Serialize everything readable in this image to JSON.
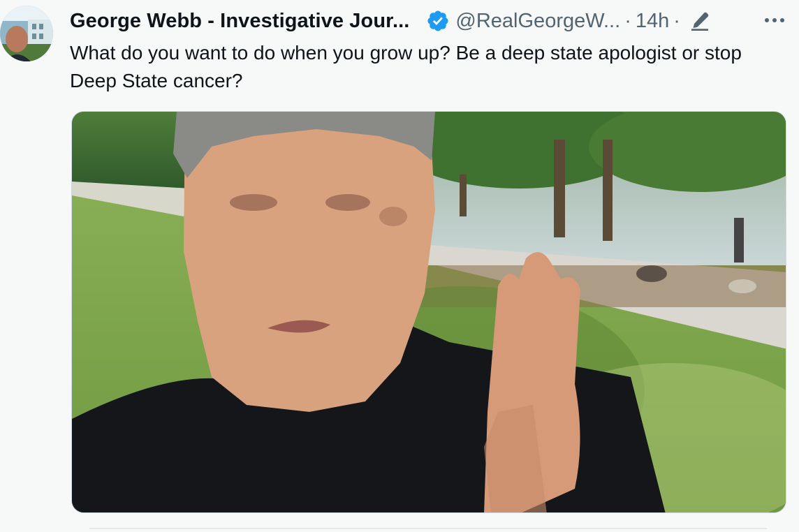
{
  "tweet": {
    "author": {
      "display_name": "George Webb - Investigative Jour...",
      "handle": "@RealGeorgeW...",
      "verified": true,
      "avatar_icon": "avatar"
    },
    "separator": "·",
    "timestamp": "14h",
    "icons": {
      "verified": "verified-badge-icon",
      "edited": "edit-icon",
      "more": "more-options-icon"
    },
    "text": "What do you want to do when you grow up? Be a deep state apologist or stop Deep State cancer?",
    "media": {
      "type": "video-thumbnail"
    }
  },
  "colors": {
    "background": "#f7f8f8",
    "text_primary": "#0f1419",
    "text_secondary": "#536471",
    "verified_blue": "#1d9bf0"
  }
}
